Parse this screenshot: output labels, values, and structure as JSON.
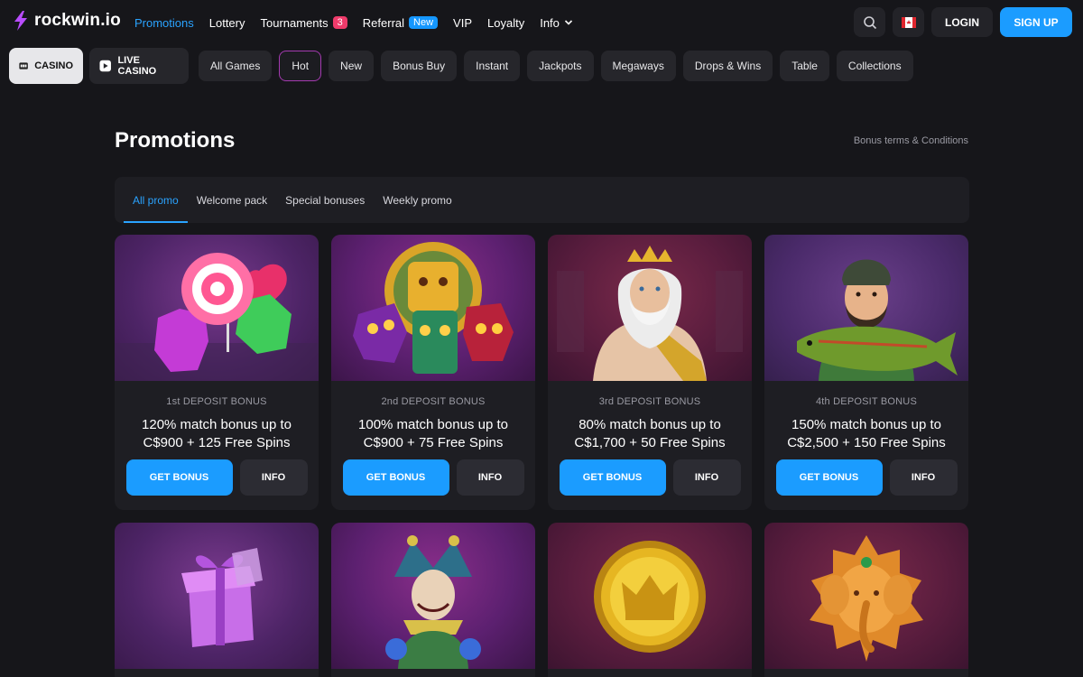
{
  "brand": {
    "name": "rockwin.io",
    "accent": "#1b9cff"
  },
  "nav": {
    "items": [
      {
        "label": "Promotions",
        "active": true
      },
      {
        "label": "Lottery"
      },
      {
        "label": "Tournaments",
        "badge": "3"
      },
      {
        "label": "Referral",
        "badge": "New"
      },
      {
        "label": "VIP"
      },
      {
        "label": "Loyalty"
      },
      {
        "label": "Info"
      }
    ]
  },
  "header": {
    "login": "LOGIN",
    "signup": "SIGN UP",
    "search_icon": "search-icon",
    "flag_icon": "canada-flag-icon"
  },
  "modes": {
    "casino": "CASINO",
    "live": "LIVE CASINO"
  },
  "categories": [
    "All Games",
    "Hot",
    "New",
    "Bonus Buy",
    "Instant",
    "Jackpots",
    "Megaways",
    "Drops & Wins",
    "Table",
    "Collections"
  ],
  "page": {
    "title": "Promotions",
    "terms": "Bonus terms & Conditions"
  },
  "tabs": [
    "All promo",
    "Welcome pack",
    "Special bonuses",
    "Weekly promo"
  ],
  "cards": [
    {
      "label": "1st DEPOSIT BONUS",
      "line1": "120% match bonus up to",
      "line2": "C$900 + 125 Free Spins",
      "get": "GET BONUS",
      "info": "INFO",
      "image": "candy-lollipop-icon"
    },
    {
      "label": "2nd DEPOSIT BONUS",
      "line1": "100% match bonus up to",
      "line2": "C$900 + 75 Free Spins",
      "get": "GET BONUS",
      "info": "INFO",
      "image": "aztec-masks-icon"
    },
    {
      "label": "3rd DEPOSIT BONUS",
      "line1": "80% match bonus up to",
      "line2": "C$1,700 + 50 Free Spins",
      "get": "GET BONUS",
      "info": "INFO",
      "image": "zeus-icon"
    },
    {
      "label": "4th DEPOSIT BONUS",
      "line1": "150% match bonus up to",
      "line2": "C$2,500 + 150 Free Spins",
      "get": "GET BONUS",
      "info": "INFO",
      "image": "fisherman-icon"
    }
  ],
  "cards_row2": [
    {
      "image": "gift-box-icon"
    },
    {
      "image": "jester-icon"
    },
    {
      "image": "gold-crown-coin-icon"
    },
    {
      "image": "golden-elephant-icon"
    }
  ]
}
